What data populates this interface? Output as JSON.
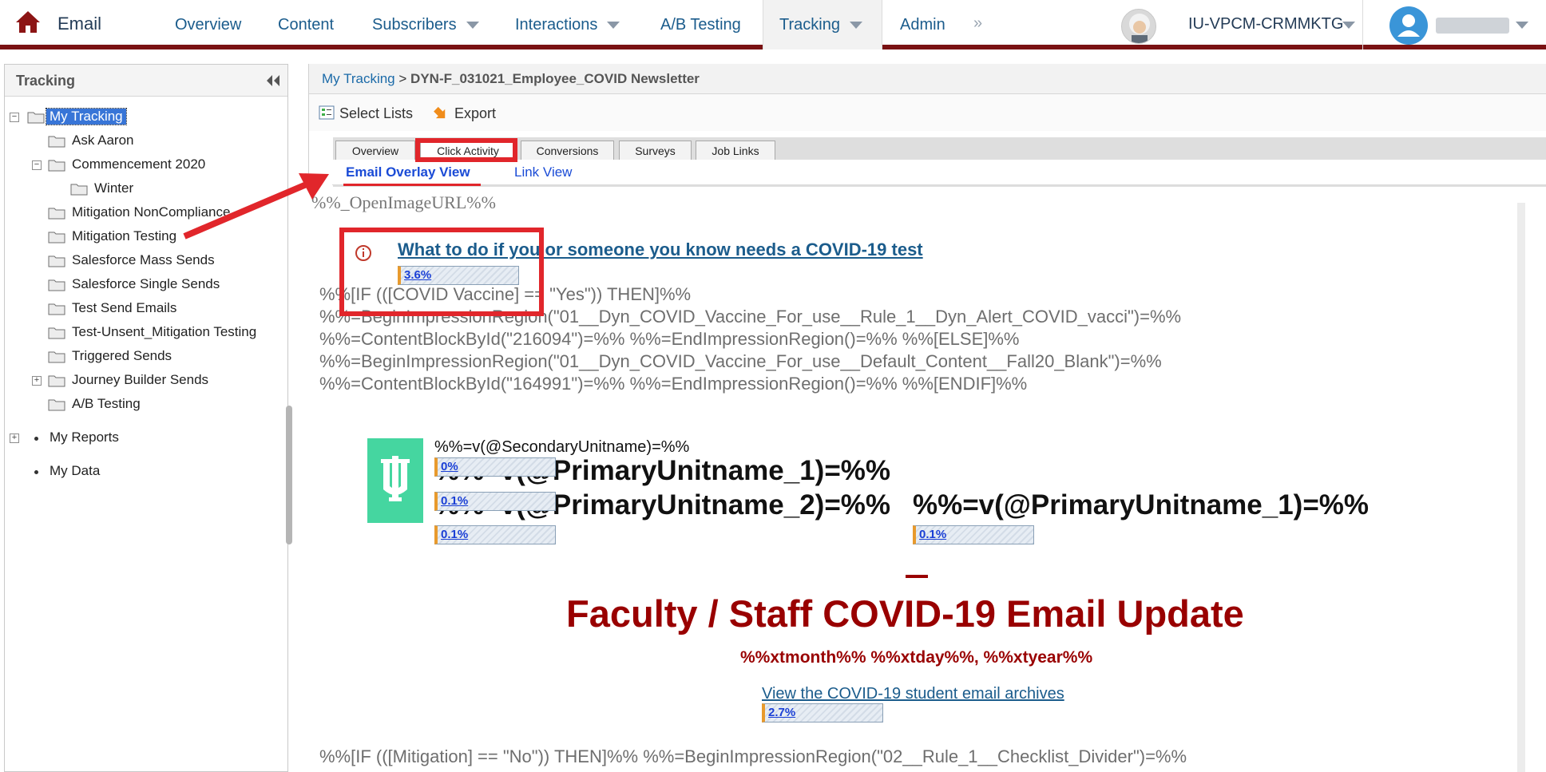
{
  "nav": {
    "app_title": "Email",
    "items": [
      "Overview",
      "Content",
      "Subscribers",
      "Interactions",
      "A/B Testing",
      "Tracking",
      "Admin"
    ],
    "more": "»",
    "org_name": "IU-VPCM-CRMMKTG"
  },
  "sidebar": {
    "title": "Tracking",
    "my_tracking": "My Tracking",
    "folders": [
      "Ask Aaron",
      "Commencement 2020",
      "Winter",
      "Mitigation NonCompliance",
      "Mitigation Testing",
      "Salesforce Mass Sends",
      "Salesforce Single Sends",
      "Test Send Emails",
      "Test-Unsent_Mitigation Testing",
      "Triggered Sends",
      "Journey Builder Sends",
      "A/B Testing"
    ],
    "my_reports": "My Reports",
    "my_data": "My Data"
  },
  "breadcrumb": {
    "link": "My Tracking",
    "separator": ">",
    "current": "DYN-F_031021_Employee_COVID Newsletter"
  },
  "toolbar": {
    "select_lists": "Select Lists",
    "export": "Export"
  },
  "tabs": [
    "Overview",
    "Click Activity",
    "Conversions",
    "Surveys",
    "Job Links"
  ],
  "subtabs": {
    "overlay": "Email Overlay View",
    "link": "Link View"
  },
  "preview": {
    "open_image_url": "%%_OpenImageURL%%",
    "covid_test_link": "What to do if you or someone you know needs a COVID-19 test",
    "covid_test_rate": "3.6%",
    "code_lines": [
      "%%[IF (([COVID Vaccine] == \"Yes\")) THEN]%%",
      "%%=BeginImpressionRegion(\"01__Dyn_COVID_Vaccine_For_use__Rule_1__Dyn_Alert_COVID_vacci\")=%%",
      "%%=ContentBlockById(\"216094\")=%% %%=EndImpressionRegion()=%% %%[ELSE]%%",
      "%%=BeginImpressionRegion(\"01__Dyn_COVID_Vaccine_For_use__Default_Content__Fall20_Blank\")=%%",
      "%%=ContentBlockById(\"164991\")=%% %%=EndImpressionRegion()=%% %%[ENDIF]%%"
    ],
    "secondary_unit": "%%=v(@SecondaryUnitname)=%%",
    "primary_unit_1": "%%=v(@PrimaryUnitname_1)=%%",
    "primary_unit_2": "%%=v(@PrimaryUnitname_2)=%%",
    "primary_unit_1b": "%%=v(@PrimaryUnitname_1)=%%",
    "rate_secondary": "0%",
    "rate_primary_1": "0.1%",
    "rate_primary_2": "0.1%",
    "rate_primary_1b": "0.1%",
    "title": "Faculty / Staff COVID-19 Email Update",
    "date": "%%xtmonth%% %%xtday%%, %%xtyear%%",
    "archive_link": "View the COVID-19 student email archives",
    "archive_rate": "2.7%",
    "bottom_code": "%%[IF (([Mitigation] == \"No\")) THEN]%% %%=BeginImpressionRegion(\"02__Rule_1__Checklist_Divider\")=%%"
  },
  "colors": {
    "brand_crimson": "#990000",
    "nav_link": "#1b5c8c",
    "annotation_red": "#e1262b",
    "selection_blue": "#3875d7",
    "iu_logo_green": "#45d6a0"
  }
}
